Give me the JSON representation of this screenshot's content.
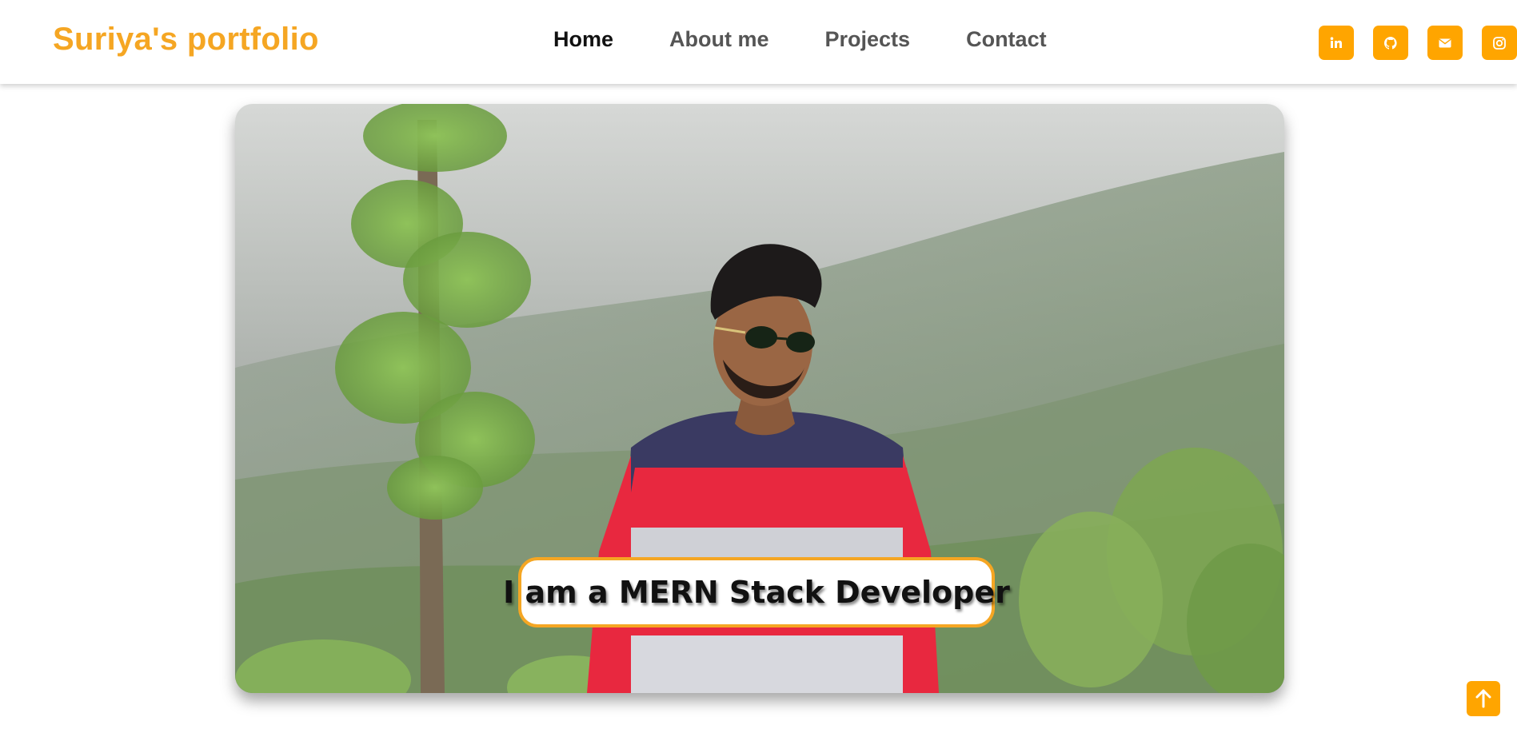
{
  "header": {
    "brand": "Suriya's portfolio",
    "nav": [
      {
        "label": "Home",
        "active": true
      },
      {
        "label": "About me",
        "active": false
      },
      {
        "label": "Projects",
        "active": false
      },
      {
        "label": "Contact",
        "active": false
      }
    ],
    "socials": [
      {
        "icon": "linkedin-icon"
      },
      {
        "icon": "github-icon"
      },
      {
        "icon": "mail-icon"
      },
      {
        "icon": "instagram-icon"
      }
    ]
  },
  "hero": {
    "caption": "I am a MERN Stack Developer"
  },
  "scroll_top": {
    "icon": "arrow-up-icon"
  },
  "colors": {
    "accent": "#ffa500",
    "brand_text": "#f5a623",
    "nav_text": "#555555",
    "nav_active": "#111111"
  }
}
